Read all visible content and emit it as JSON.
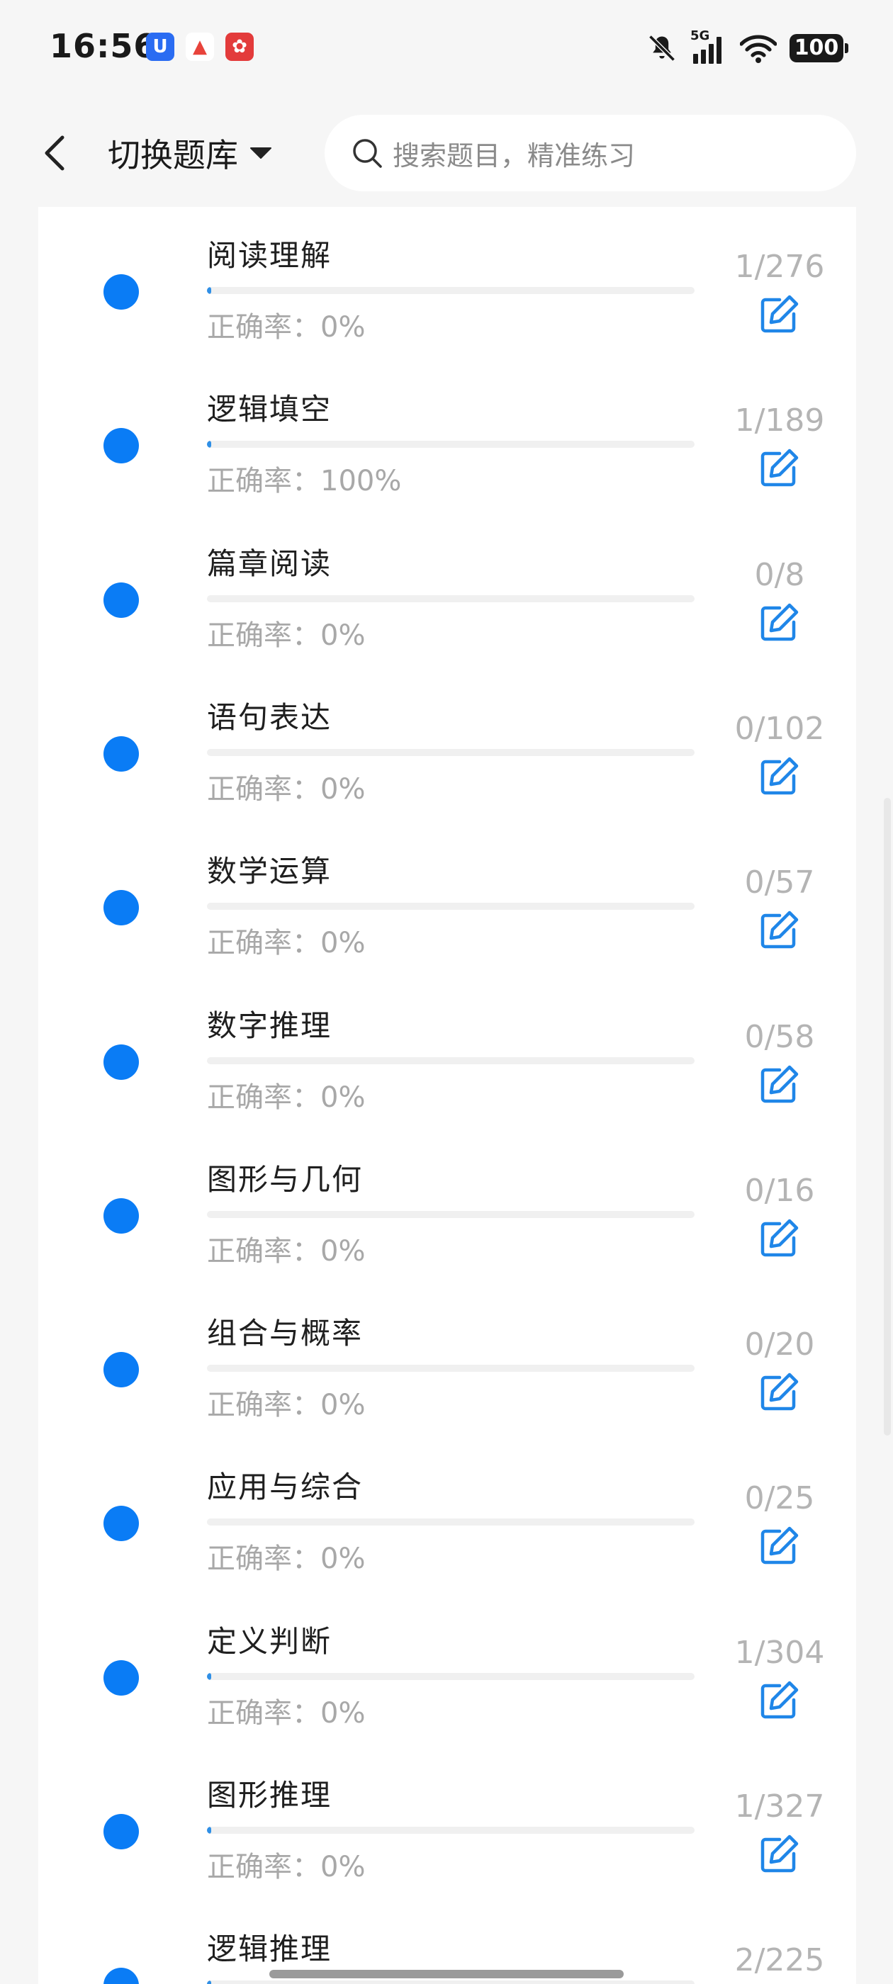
{
  "status_bar": {
    "time": "16:56",
    "network": "5G",
    "battery": "100",
    "app_icons": [
      {
        "icon": "notification-app-icon-blue",
        "glyph": "U",
        "color": "#2a6cf2"
      },
      {
        "icon": "notification-app-icon-red-triangle",
        "glyph": "▲",
        "color": "#e8433b"
      },
      {
        "icon": "notification-app-icon-red-square",
        "glyph": "✿",
        "color": "#e33b3b"
      }
    ]
  },
  "header": {
    "switch_label": "切换题库",
    "search_placeholder": "搜索题目，精准练习"
  },
  "colors": {
    "accent": "#0a7cf5",
    "progress": "#2f8fe6",
    "muted_text": "#a8a8a8"
  },
  "categories": [
    {
      "title": "阅读理解",
      "accuracy": "正确率：0%",
      "count": "1/276",
      "progress": 0.0036
    },
    {
      "title": "逻辑填空",
      "accuracy": "正确率：100%",
      "count": "1/189",
      "progress": 0.0053
    },
    {
      "title": "篇章阅读",
      "accuracy": "正确率：0%",
      "count": "0/8",
      "progress": 0
    },
    {
      "title": "语句表达",
      "accuracy": "正确率：0%",
      "count": "0/102",
      "progress": 0
    },
    {
      "title": "数学运算",
      "accuracy": "正确率：0%",
      "count": "0/57",
      "progress": 0
    },
    {
      "title": "数字推理",
      "accuracy": "正确率：0%",
      "count": "0/58",
      "progress": 0
    },
    {
      "title": "图形与几何",
      "accuracy": "正确率：0%",
      "count": "0/16",
      "progress": 0
    },
    {
      "title": "组合与概率",
      "accuracy": "正确率：0%",
      "count": "0/20",
      "progress": 0
    },
    {
      "title": "应用与综合",
      "accuracy": "正确率：0%",
      "count": "0/25",
      "progress": 0
    },
    {
      "title": "定义判断",
      "accuracy": "正确率：0%",
      "count": "1/304",
      "progress": 0.0033
    },
    {
      "title": "图形推理",
      "accuracy": "正确率：0%",
      "count": "1/327",
      "progress": 0.0031
    },
    {
      "title": "逻辑推理",
      "accuracy": "",
      "count": "2/225",
      "progress": 0.0089
    }
  ]
}
